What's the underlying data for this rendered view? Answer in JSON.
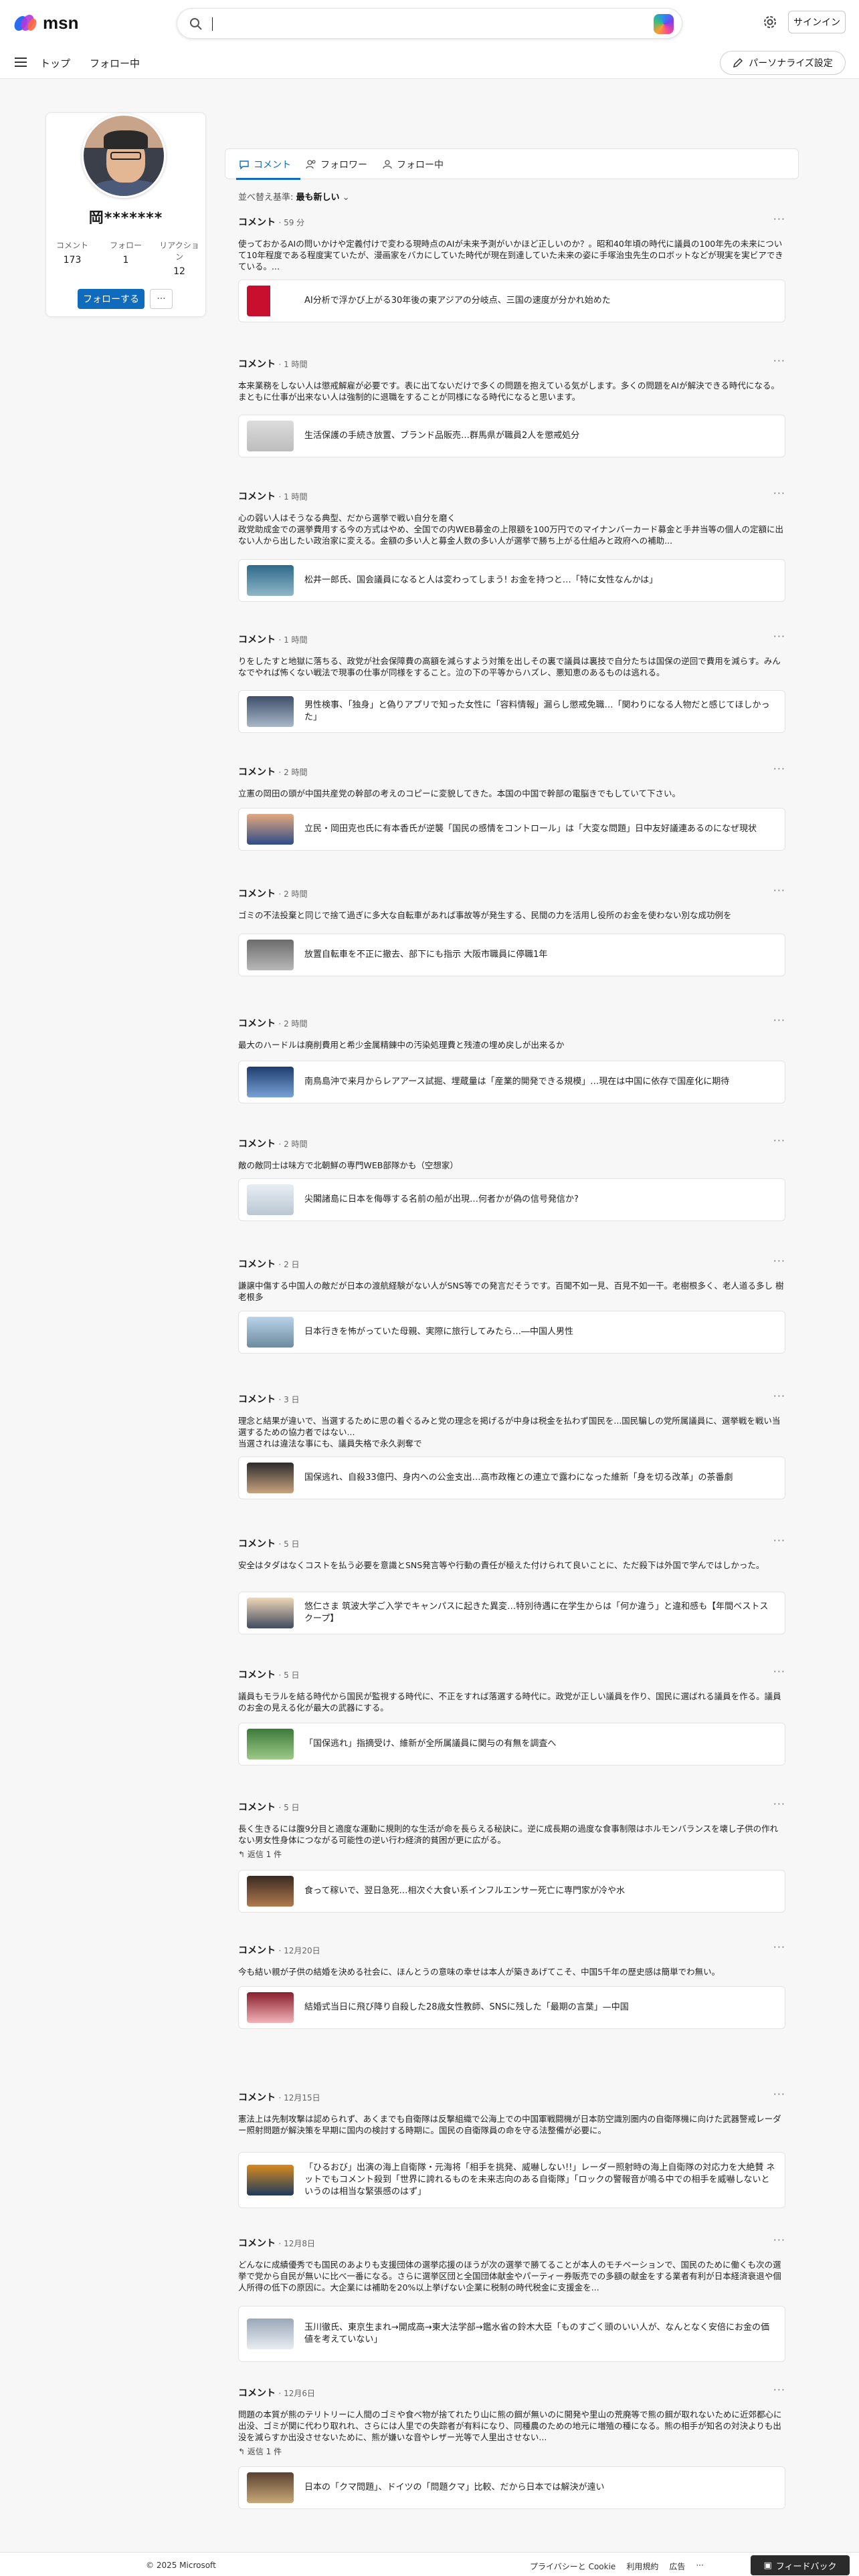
{
  "header": {
    "logo_text": "msn",
    "search_placeholder": "",
    "signin_label": "サインイン",
    "nav": [
      "トップ",
      "フォロー中"
    ],
    "personalize_label": "パーソナライズ設定"
  },
  "profile": {
    "name": "岡*******",
    "stats": [
      {
        "label": "コメント",
        "value": "173"
      },
      {
        "label": "フォロー",
        "value": "1"
      },
      {
        "label": "リアクション",
        "value": "12"
      }
    ],
    "follow_label": "フォローする",
    "more_label": "···"
  },
  "tabs": [
    {
      "label": "コメント",
      "icon": "comment-icon"
    },
    {
      "label": "フォロワー",
      "icon": "followers-icon"
    },
    {
      "label": "フォロー中",
      "icon": "following-icon"
    }
  ],
  "sort": {
    "label": "並べ替え基準:",
    "value": "最も新しい"
  },
  "comments": [
    {
      "head": "コメント",
      "time": "59 分",
      "text": "使っておかるAIの問いかけや定義付けで変わる現時点のAIが未来予測がいかほど正しいのか？。昭和40年頃の時代に議員の100年先の未来について10年程度である程度実ていたが、漫画家をバカにしていた時代が現在到達していた未来の姿に手塚治虫先生のロボットなどが現実を実ビアできている。...",
      "reply": "",
      "article": "AI分析で浮かび上がる30年後の東アジアの分岐点、三国の速度が分かれ始めた"
    },
    {
      "head": "コメント",
      "time": "1 時間",
      "text": "本来業務をしない人は懲戒解雇が必要です。表に出てないだけで多くの問題を抱えている気がします。多くの問題をAIが解決できる時代になる。まともに仕事が出来ない人は強制的に退職をすることが同様になる時代になると思います。",
      "reply": "",
      "article": "生活保護の手続き放置、ブランド品販売…群馬県が職員2人を懲戒処分"
    },
    {
      "head": "コメント",
      "time": "1 時間",
      "text": "心の弱い人はそうなる典型、だから選挙で戦い自分を磨く\n政党助成金での選挙費用する今の方式はやめ、全国での内WEB募金の上限額を100万円でのマイナンバーカード募金と手井当等の個人の定額に出ない人から出したい政治家に変える。金額の多い人と募金人数の多い人が選挙で勝ち上がる仕組みと政府への補助...",
      "reply": "",
      "article": "松井一郎氏、国会議員になると人は変わってしまう! お金を持つと…「特に女性なんかは」"
    },
    {
      "head": "コメント",
      "time": "1 時間",
      "text": "りをしたすと地獄に落ちる、政党が社会保障費の高額を減らすよう対策を出しその裏で議員は裏技で自分たちは国保の逆回で費用を減らす。みんなでやれば怖くない戦法で現事の仕事が同様をすること。泣の下の平等からハズレ、悪知恵のあるものは逃れる。",
      "reply": "",
      "article": "男性検事、「独身」と偽りアプリで知った女性に「容料情報」漏らし懲戒免職…「関わりになる人物だと感じてほしかった」"
    },
    {
      "head": "コメント",
      "time": "2 時間",
      "text": "立憲の岡田の頭が中国共産党の幹部の考えのコピーに変貌してきた。本国の中国で幹部の電脳きでもしていて下さい。",
      "reply": "",
      "article": "立民・岡田克也氏に有本香氏が逆襲「国民の感情をコントロール」は「大変な問題」日中友好議連あるのになぜ現状"
    },
    {
      "head": "コメント",
      "time": "2 時間",
      "text": "ゴミの不法投棄と同じで捨て過ぎに多大な自転車があれば事故等が発生する、民間の力を活用し役所のお金を使わない別な成功例を",
      "reply": "",
      "article": "放置自転車を不正に撤去、部下にも指示 大阪市職員に停職1年"
    },
    {
      "head": "コメント",
      "time": "2 時間",
      "text": "最大のハードルは廃削費用と希少金属精錬中の汚染処理費と残渣の埋め戻しが出来るか",
      "reply": "",
      "article": "南鳥島沖で来月からレアアース試掘、埋蔵量は「産業的開発できる規模」…現在は中国に依存で国産化に期待"
    },
    {
      "head": "コメント",
      "time": "2 時間",
      "text": "敵の敵同士は味方で北朝鮮の専門WEB部隊かも（空想家）",
      "reply": "",
      "article": "尖閣諸島に日本を侮辱する名前の船が出現…何者かが偽の信号発信か?"
    },
    {
      "head": "コメント",
      "time": "2 日",
      "text": "謙譲中傷する中国人の敵だが日本の渡航経験がない人がSNS等での発言だそうです。百聞不如一見、百見不如一干。老樹根多く、老人道る多し 樹老根多",
      "reply": "",
      "article": "日本行きを怖がっていた母親、実際に旅行してみたら…―中国人男性"
    },
    {
      "head": "コメント",
      "time": "3 日",
      "text": "理念と結果が違いで、当選するために思の着ぐるみと党の理念を掲げるが中身は税金を払わず国民を...国民騙しの党所属議員に、選挙戦を戦い当選するための協力者ではない...\n当選されは違法な事にも、議員失格で永久剥奪で",
      "reply": "",
      "article": "国保逃れ、自殺33億円、身内への公金支出…高市政権との連立で露わになった維新「身を切る改革」の茶番劇"
    },
    {
      "head": "コメント",
      "time": "5 日",
      "text": "安全はタダはなくコストを払う必要を意識とSNS発言等や行動の責任が極えた付けられて良いことに、ただ殺下は外国で学んではしかった。",
      "reply": "",
      "article": "悠仁さま 筑波大学ご入学でキャンパスに起きた異変…特別待遇に在学生からは「何か違う」と違和感も【年間ベストスクープ】"
    },
    {
      "head": "コメント",
      "time": "5 日",
      "text": "議員もモラルを結る時代から国民が監視する時代に、不正をすれば落選する時代に。政党が正しい議員を作り、国民に選ばれる議員を作る。議員のお金の見える化が最大の武器にする。",
      "reply": "",
      "article": "「国保逃れ」指摘受け、維新が全所属議員に関与の有無を調査へ"
    },
    {
      "head": "コメント",
      "time": "5 日",
      "text": "長く生きるには腹9分目と適度な運動に規則的な生活が命を長らえる秘訣に。逆に成長期の過度な食事制限はホルモンバランスを壊し子供の作れない男女性身体につながる可能性の逆い行わ経済的貧困が更に広がる。",
      "reply": "↰ 返信 1 件",
      "article": "食って稼いで、翌日急死…相次ぐ大食い系インフルエンサー死亡に専門家が冷や水"
    },
    {
      "head": "コメント",
      "time": "12月20日",
      "text": "今も結い親が子供の結婚を決める社会に、ほんとうの意味の幸せは本人が築きあげてこそ、中国5千年の歴史感は簡単でわ無い。",
      "reply": "",
      "article": "結婚式当日に飛び降り自殺した28歳女性教師、SNSに残した「最期の言葉」—中国"
    },
    {
      "head": "コメント",
      "time": "12月15日",
      "text": "憲法上は先制攻撃は認められず、あくまでも自衛隊は反撃組織で公海上での中国軍戦闘機が日本防空識別圏内の自衛隊機に向けた武器警戒レーダー照射問題が解決策を早期に国内の検討する時期に。国民の自衛隊員の命を守る法整備が必要に。",
      "reply": "",
      "article": "「ひるおび」出演の海上自衛隊・元海将「相手を挑発、威嚇しない!!」レーダー照射時の海上自衛隊の対応力を大絶賛 ネットでもコメント殺到「世界に誇れるものを未来志向のある自衛隊」「ロックの警報音が鳴る中での相手を威嚇しないというのは相当な緊張感のはず」"
    },
    {
      "head": "コメント",
      "time": "12月8日",
      "text": "どんなに成績優秀でも国民のあよりも支援団体の選挙応援のほうが次の選挙で勝てることが本人のモチベーションで、国民のために働くも次の選挙で党から自民が無いに比べ一番になる。さらに選挙区団と全国団体献金やパーティー券販売での多額の献金をする業者有利が日本経済衰退や個人所得の低下の原因に。大企業には補助を20%以上挙げない企業に税制の時代税金に支援金を...",
      "reply": "",
      "article": "玉川徹氏、東京生まれ→開成高→東大法学部→鑑水省の鈴木大臣「ものすごく頭のいい人が、なんとなく安倍にお金の価値を考えていない」"
    },
    {
      "head": "コメント",
      "time": "12月6日",
      "text": "問題の本質が熊のテリトリーに人間のゴミや食べ物が捨てれたり山に熊の餌が無いのに開発や里山の荒廃等で熊の餌が取れないために近郊都心に出没、ゴミが関に代わり取れれ、さらには人里での失踪者が有料になり、同種農のための地元に増殖の種になる。熊の相手が知名の対決よりも出没を減らすか出没させないために、熊が嫌いな音やレザー光等で人里出させない...",
      "reply": "↰ 返信 1 件",
      "article": "日本の「クマ問題」、ドイツの「問題クマ」比較、だから日本では解決が遠い"
    }
  ],
  "footer": {
    "copyright": "© 2025 Microsoft",
    "links": [
      "プライバシーと Cookie",
      "利用規約",
      "広告",
      "···"
    ],
    "feedback_label": "フィードバック"
  }
}
